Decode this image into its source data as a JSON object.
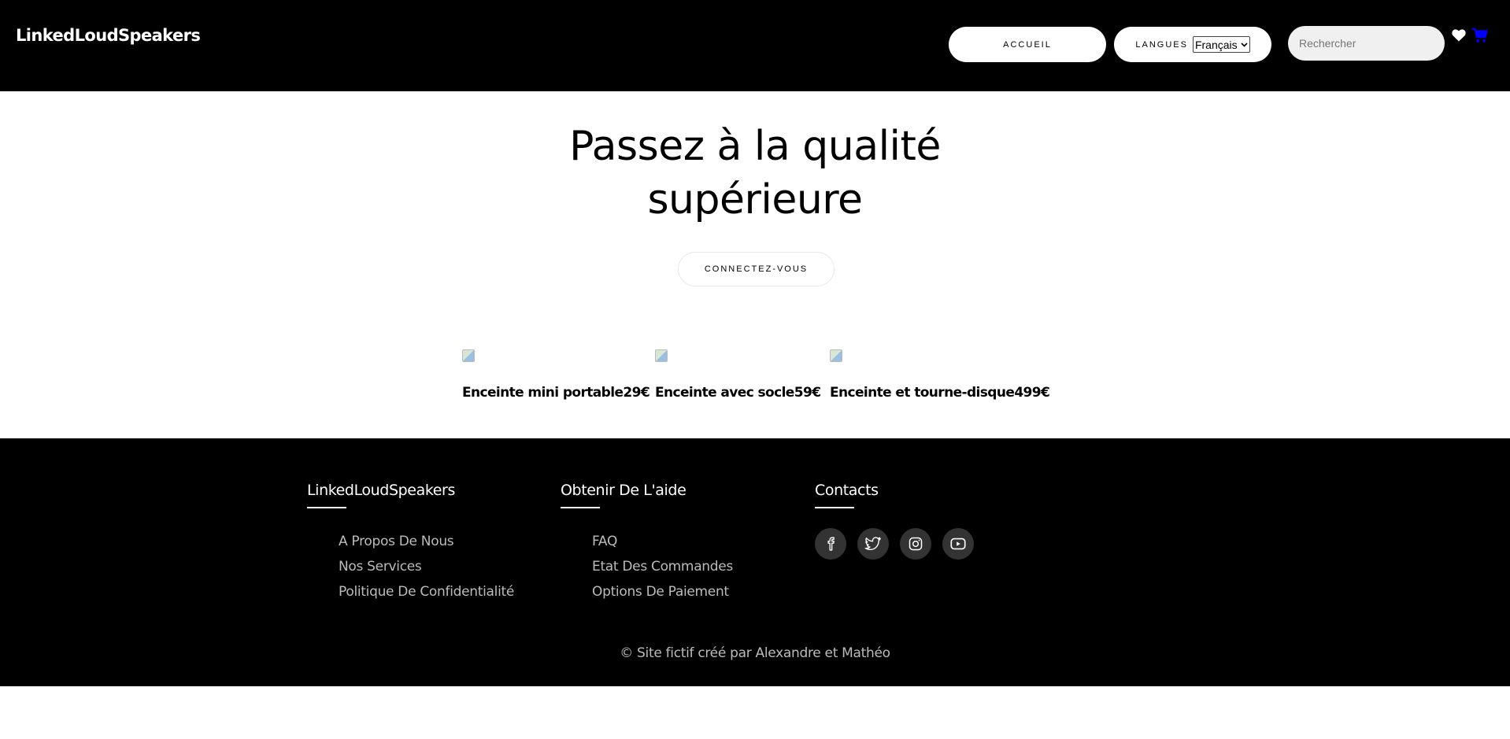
{
  "header": {
    "logo": "LinkedLoudSpeakers",
    "nav_home": "ACCUEIL",
    "nav_lang_label": "LANGUES",
    "lang_selected": "Français",
    "search_placeholder": "Rechercher",
    "icons": {
      "favorites": "heart-icon",
      "cart": "cart-icon"
    },
    "colors": {
      "header_bg": "#000000",
      "cart_icon": "#0000ff"
    }
  },
  "hero": {
    "title_line1": "Passez à la qualité",
    "title_line2": "supérieure",
    "cta_label": "CONNECTEZ-VOUS"
  },
  "products": [
    {
      "name": "Enceinte mini portable",
      "price": "29€"
    },
    {
      "name": "Enceinte avec socle",
      "price": "59€"
    },
    {
      "name": "Enceinte et tourne-disque",
      "price": "499€"
    }
  ],
  "footer": {
    "columns": [
      {
        "title": "LinkedLoudSpeakers",
        "links": [
          "A Propos De Nous",
          "Nos Services",
          "Politique De Confidentialité"
        ]
      },
      {
        "title": "Obtenir De L'aide",
        "links": [
          "FAQ",
          "Etat Des Commandes",
          "Options De Paiement"
        ]
      },
      {
        "title": "Contacts",
        "socials": [
          "facebook-icon",
          "twitter-icon",
          "instagram-icon",
          "youtube-icon"
        ]
      }
    ],
    "copyright": "© Site fictif créé par Alexandre et Mathéo"
  }
}
